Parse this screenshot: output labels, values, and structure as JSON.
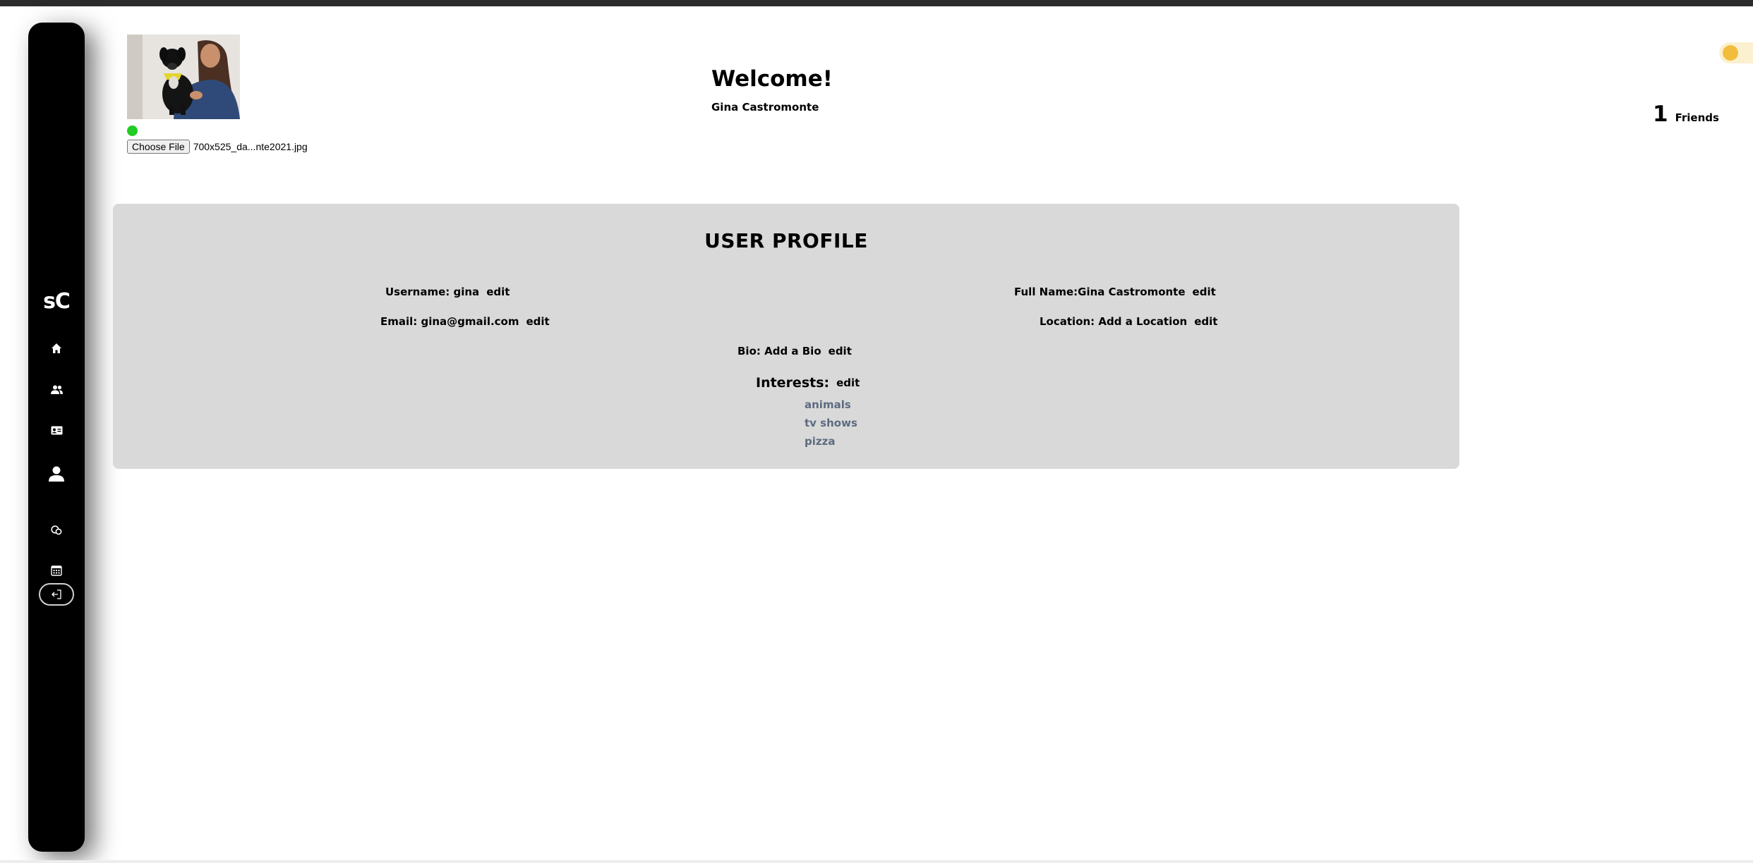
{
  "sidebar": {
    "logo": "sC",
    "items": [
      {
        "icon": "home-icon"
      },
      {
        "icon": "people-icon"
      },
      {
        "icon": "id-card-icon"
      },
      {
        "icon": "user-icon"
      },
      {
        "icon": "chat-bubbles-icon"
      },
      {
        "icon": "calendar-icon"
      }
    ],
    "logout_icon": "logout-icon"
  },
  "header": {
    "welcome": "Welcome!",
    "name": "Gina Castromonte",
    "friends_count": "1",
    "friends_label": "Friends",
    "status_color": "#22cc22"
  },
  "upload": {
    "button_label": "Choose File",
    "file_name": "700x525_da...nte2021.jpg"
  },
  "profile": {
    "title": "USER PROFILE",
    "username": "Username: gina",
    "full_name": "Full Name:Gina Castromonte",
    "email": "Email: gina@gmail.com",
    "location": "Location: Add a Location",
    "bio": "Bio: Add a Bio",
    "interests_label": "Interests:",
    "edit_label": "edit",
    "interests": [
      "animals",
      "tv shows",
      "pizza"
    ]
  },
  "colors": {
    "sidebar": "#000000",
    "card": "#d9d9d9",
    "interest_text": "#5d6b80",
    "toggle_knob": "#f2bd3d"
  }
}
